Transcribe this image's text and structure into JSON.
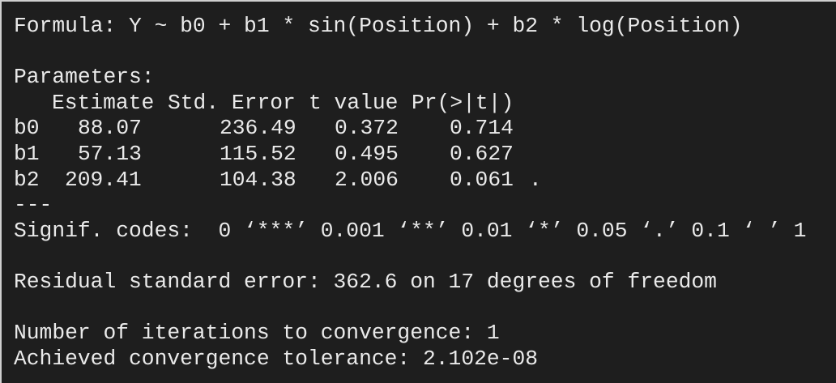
{
  "output": {
    "formula": "Formula: Y ~ b0 + b1 * sin(Position) + b2 * log(Position)",
    "parameters_heading": "Parameters:",
    "table": {
      "headers": [
        "Estimate",
        "Std. Error",
        "t value",
        "Pr(>|t|)"
      ],
      "rows": [
        {
          "name": "b0",
          "estimate": "88.07",
          "std_error": "236.49",
          "t_value": "0.372",
          "p_value": "0.714",
          "signif": ""
        },
        {
          "name": "b1",
          "estimate": "57.13",
          "std_error": "115.52",
          "t_value": "0.495",
          "p_value": "0.627",
          "signif": ""
        },
        {
          "name": "b2",
          "estimate": "209.41",
          "std_error": "104.38",
          "t_value": "2.006",
          "p_value": "0.061",
          "signif": "."
        }
      ]
    },
    "separator": "---",
    "signif_codes": "Signif. codes:  0 ‘***’ 0.001 ‘**’ 0.01 ‘*’ 0.05 ‘.’ 0.1 ‘ ’ 1",
    "residual_se": "Residual standard error: 362.6 on 17 degrees of freedom",
    "iterations": "Number of iterations to convergence: 1",
    "tolerance": "Achieved convergence tolerance: 2.102e-08"
  }
}
